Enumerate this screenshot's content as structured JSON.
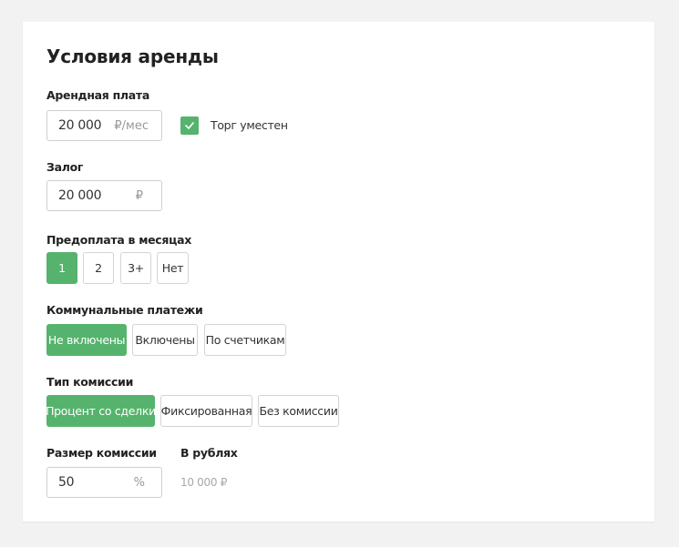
{
  "page": {
    "title": "Условия аренды"
  },
  "rent": {
    "label": "Арендная плата",
    "value": "20 000",
    "unit": "₽/мес",
    "bargain_label": "Торг уместен",
    "bargain_checked": true
  },
  "deposit": {
    "label": "Залог",
    "value": "20 000",
    "unit": "₽"
  },
  "prepayment": {
    "label": "Предоплата в месяцах",
    "options": [
      "1",
      "2",
      "3+",
      "Нет"
    ],
    "selected": "1"
  },
  "utilities": {
    "label": "Коммунальные платежи",
    "options": [
      "Не включены",
      "Включены",
      "По счетчикам"
    ],
    "selected": "Не включены"
  },
  "commission_type": {
    "label": "Тип комиссии",
    "options": [
      "Процент со сделки",
      "Фиксированная",
      "Без комиссии"
    ],
    "selected": "Процент со сделки"
  },
  "commission_size": {
    "label": "Размер комиссии",
    "value": "50",
    "unit": "%",
    "rubles_label": "В рублях",
    "rubles_value": "10 000 ₽"
  },
  "colors": {
    "accent": "#56b36d",
    "border": "#cfcfcf",
    "background": "#f2f2f2"
  }
}
